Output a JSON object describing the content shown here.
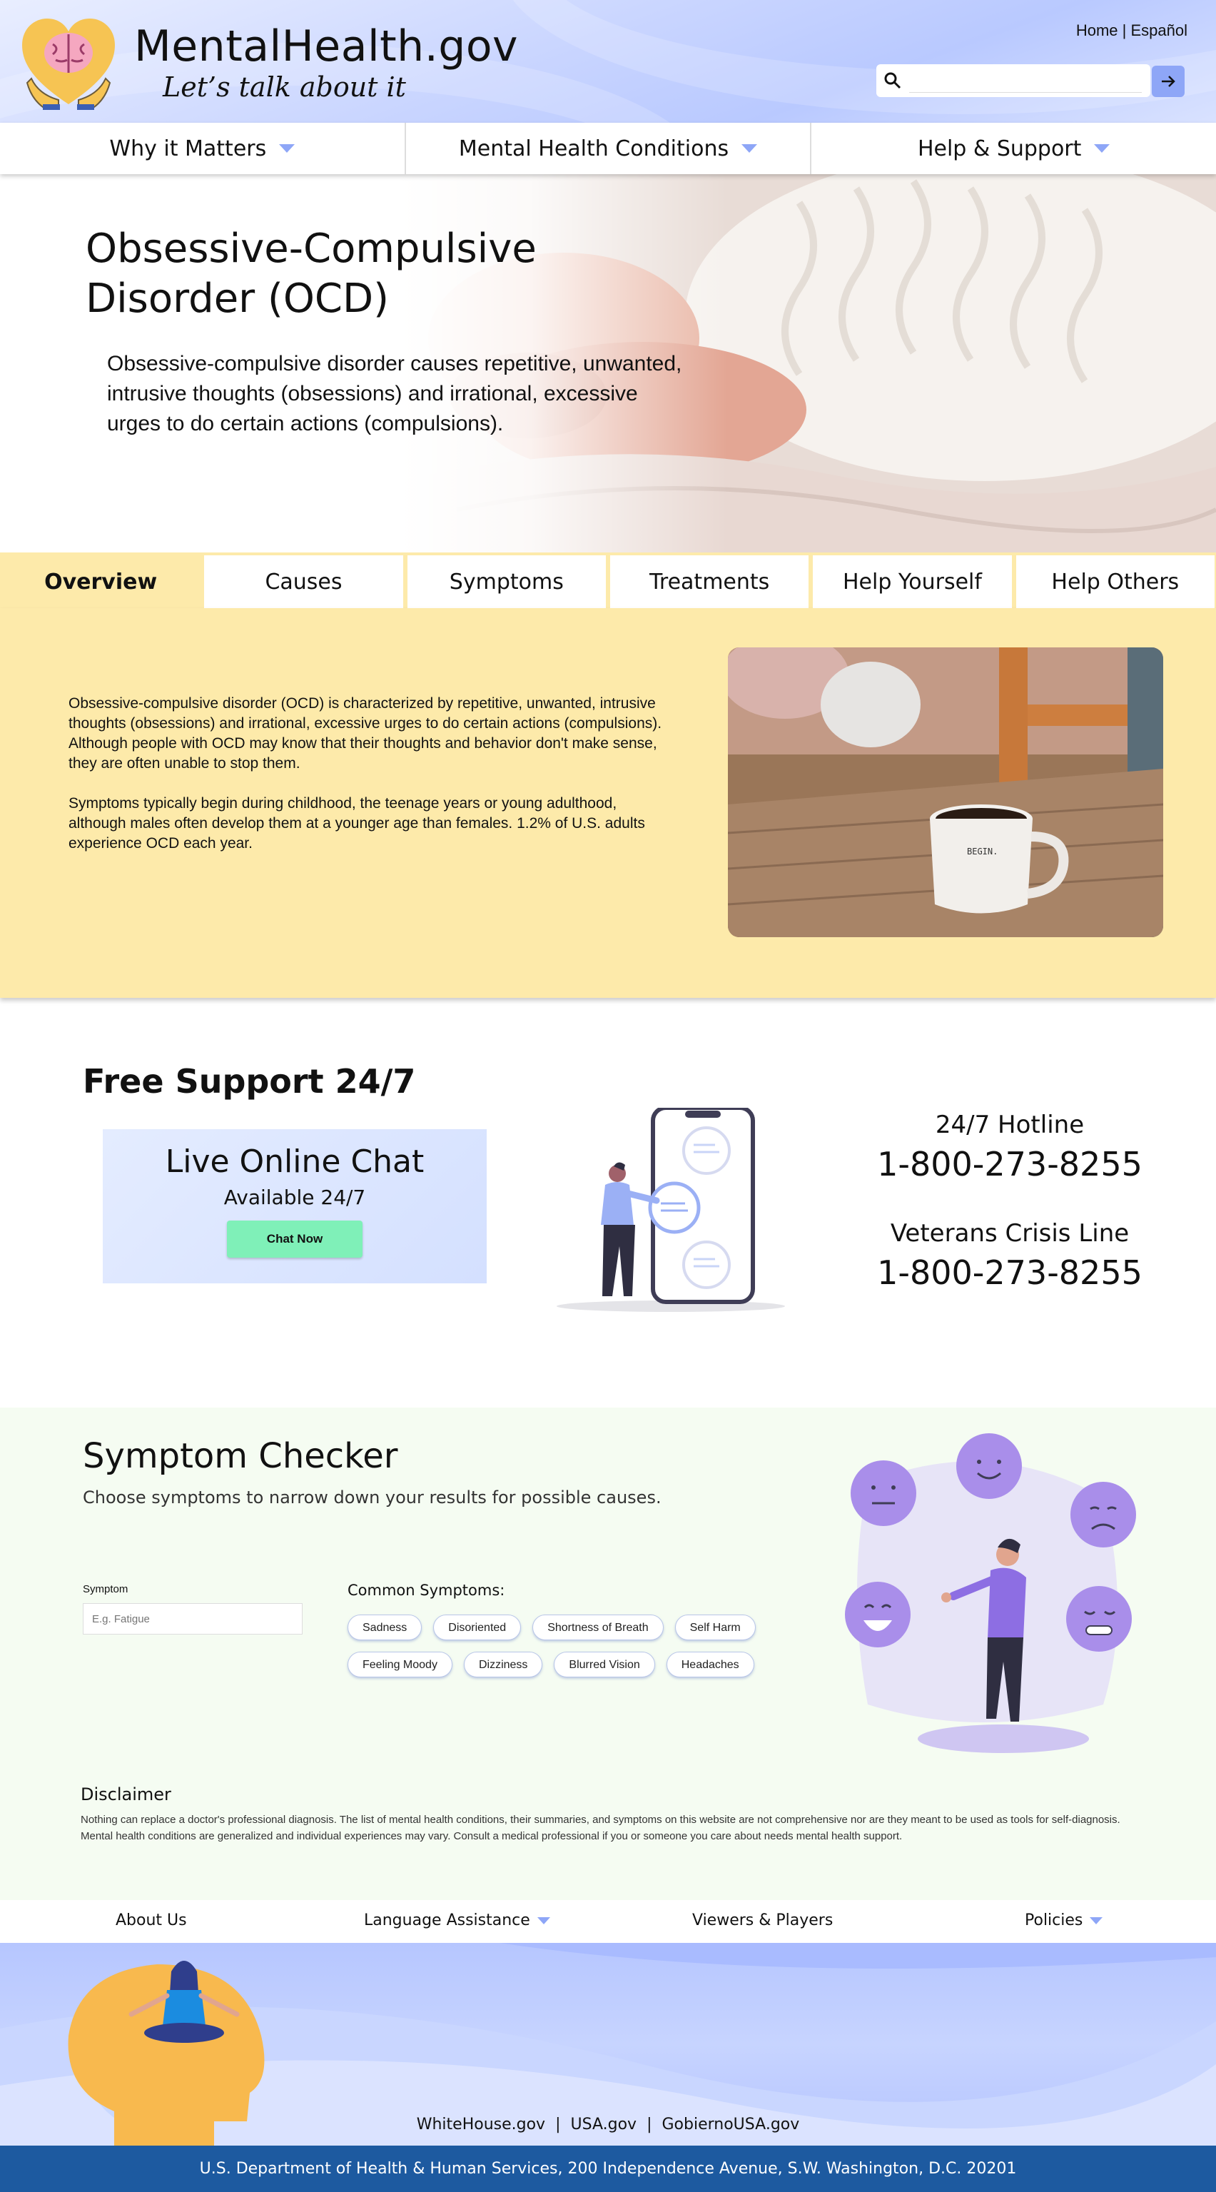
{
  "header": {
    "brand": "MentalHealth.gov",
    "tagline": "Let’s talk about it",
    "home_link": "Home",
    "separator": " | ",
    "espanol_link": "Español",
    "search_placeholder": ""
  },
  "nav": {
    "items": [
      {
        "label": "Why it Matters"
      },
      {
        "label": "Mental Health Conditions"
      },
      {
        "label": "Help & Support"
      }
    ]
  },
  "hero": {
    "title": "Obsessive-Compulsive Disorder (OCD)",
    "description": "Obsessive-compulsive disorder causes repetitive, unwanted, intrusive thoughts (obsessions) and irrational, excessive urges to do certain actions (compulsions)."
  },
  "tabs": [
    {
      "label": "Overview",
      "active": true
    },
    {
      "label": "Causes"
    },
    {
      "label": "Symptoms"
    },
    {
      "label": "Treatments"
    },
    {
      "label": "Help Yourself"
    },
    {
      "label": "Help Others"
    }
  ],
  "overview": {
    "paragraph1": "Obsessive-compulsive disorder (OCD) is characterized by repetitive, unwanted, intrusive thoughts (obsessions) and irrational, excessive urges to do certain actions (compulsions). Although people with OCD may know that their thoughts and behavior don't make sense, they are often unable to stop them.",
    "paragraph2": "Symptoms typically begin during childhood, the teenage years or young adulthood, although males often develop them at a younger age than females. 1.2% of U.S. adults experience OCD each year.",
    "mug_text": "BEGIN."
  },
  "support": {
    "title": "Free Support 24/7",
    "chat_title": "Live Online Chat",
    "chat_subtitle": "Available 24/7",
    "chat_button": "Chat Now",
    "hotline_label": "24/7 Hotline",
    "hotline_number": "1-800-273-8255",
    "veterans_label": "Veterans Crisis Line",
    "veterans_number": "1-800-273-8255"
  },
  "checker": {
    "title": "Symptom Checker",
    "subtitle": "Choose symptoms to narrow down your results for possible causes.",
    "symptom_label": "Symptom",
    "symptom_placeholder": "E.g. Fatigue",
    "common_title": "Common Symptoms:",
    "chips": [
      "Sadness",
      "Disoriented",
      "Shortness of Breath",
      "Self Harm",
      "Feeling Moody",
      "Dizziness",
      "Blurred Vision",
      "Headaches"
    ]
  },
  "disclaimer": {
    "title": "Disclaimer",
    "text": "Nothing can replace a doctor's professional diagnosis. The list of mental health conditions, their summaries, and symptoms on this website are not comprehensive nor are they meant to be used as tools for self-diagnosis. Mental health conditions are generalized and individual experiences may vary. Consult a medical professional if you or someone you care about needs mental health support."
  },
  "footer": {
    "nav": [
      "About Us",
      "Language Assistance",
      "Viewers & Players",
      "Policies"
    ],
    "links": [
      "WhiteHouse.gov",
      "USA.gov",
      "GobiernoUSA.gov"
    ],
    "link_separator": "|",
    "address": "U.S. Department of Health & Human Services, 200 Independence Avenue, S.W. Washington, D.C. 20201"
  },
  "colors": {
    "accent": "#8ea6f7",
    "tab_bg": "#fdeaaa",
    "chat_button": "#7ff0b8",
    "bottom_bar": "#1d5aa0",
    "checker_bg": "#f5fcf2"
  }
}
